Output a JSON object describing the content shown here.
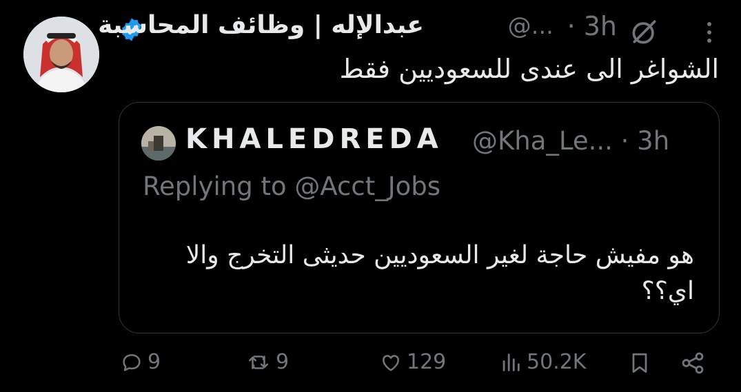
{
  "tweet": {
    "author_name": "عبدالإله | وظائف المحاسبة",
    "handle": "@...",
    "time": "· 3h",
    "text": "الشواغر الى عندى للسعوديين فقط"
  },
  "quote": {
    "author_name": "KHALEDREDA",
    "handle": "@Kha_Le... · 3h",
    "replying": "Replying to @Acct_Jobs",
    "text": "هو مفيش حاجة لغير السعوديين حديثى التخرج والا اي؟؟"
  },
  "actions": {
    "replies": "9",
    "retweets": "9",
    "likes": "129",
    "views": "50.2K"
  },
  "colors": {
    "background": "#000000",
    "text": "#e7e9ea",
    "muted": "#71767b",
    "verified": "#1d9bf0",
    "border": "#2f3336"
  },
  "icons": [
    "more-icon",
    "grok-icon",
    "verified-icon",
    "reply-icon",
    "retweet-icon",
    "like-icon",
    "views-icon",
    "bookmark-icon",
    "share-icon"
  ]
}
